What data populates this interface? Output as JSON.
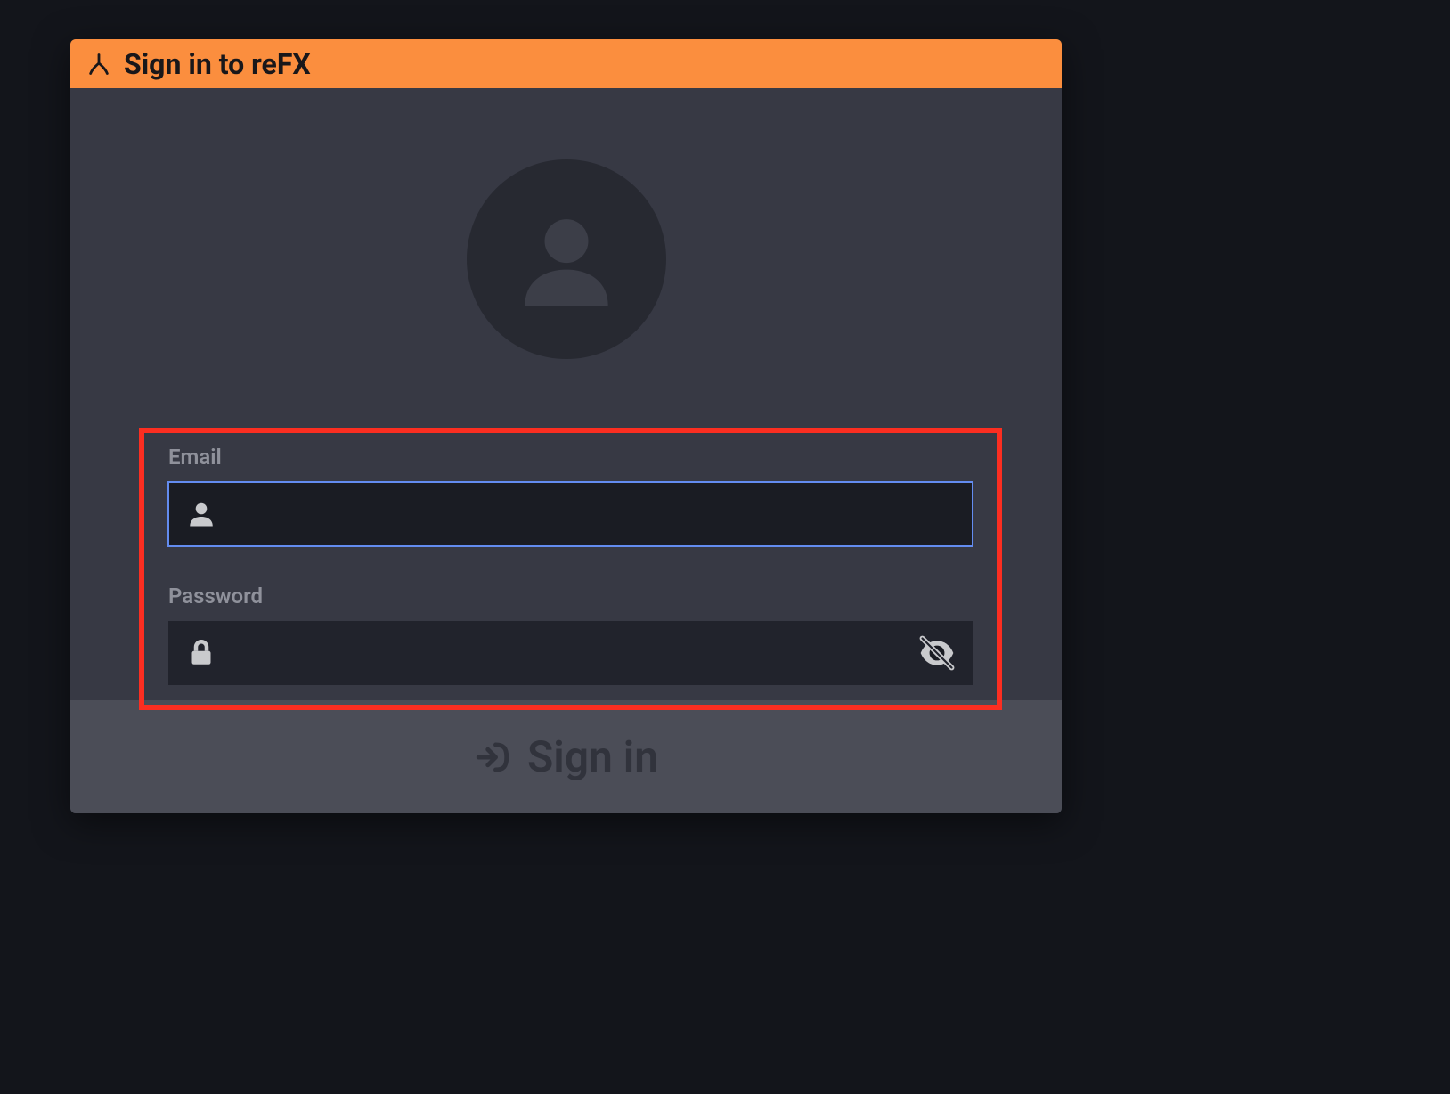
{
  "window": {
    "title": "Sign in to reFX"
  },
  "form": {
    "email_label": "Email",
    "email_value": "",
    "password_label": "Password",
    "password_value": ""
  },
  "actions": {
    "signin_label": "Sign in"
  },
  "icons": {
    "brand": "refx-logo",
    "avatar": "user-avatar",
    "email": "person",
    "password": "lock",
    "toggle_visibility": "eye-off",
    "signin": "enter"
  },
  "colors": {
    "accent": "#fb8e3e",
    "highlight_border": "#fb2e21",
    "focus_ring": "#638cf0",
    "background": "#13151b",
    "panel": "#373944",
    "footer": "#4b4d57"
  }
}
